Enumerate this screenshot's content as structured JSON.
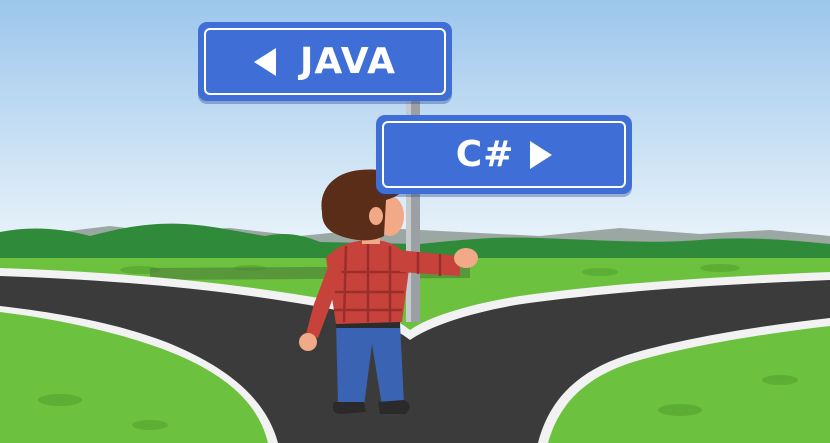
{
  "signs": {
    "java": {
      "label": "JAVA",
      "arrow_icon": "arrow-left-icon"
    },
    "csharp": {
      "label": "C#",
      "arrow_icon": "arrow-right-icon"
    }
  },
  "colors": {
    "sign_blue": "#3f6fd6",
    "sky_top": "#9cc6ec",
    "sky_bottom": "#eef6fb",
    "grass": "#6cc13e",
    "hills": "#2f8a3a",
    "road": "#3b3b3b",
    "shirt": "#c8423c",
    "jeans": "#3b63b3",
    "hair": "#5a2d18"
  }
}
